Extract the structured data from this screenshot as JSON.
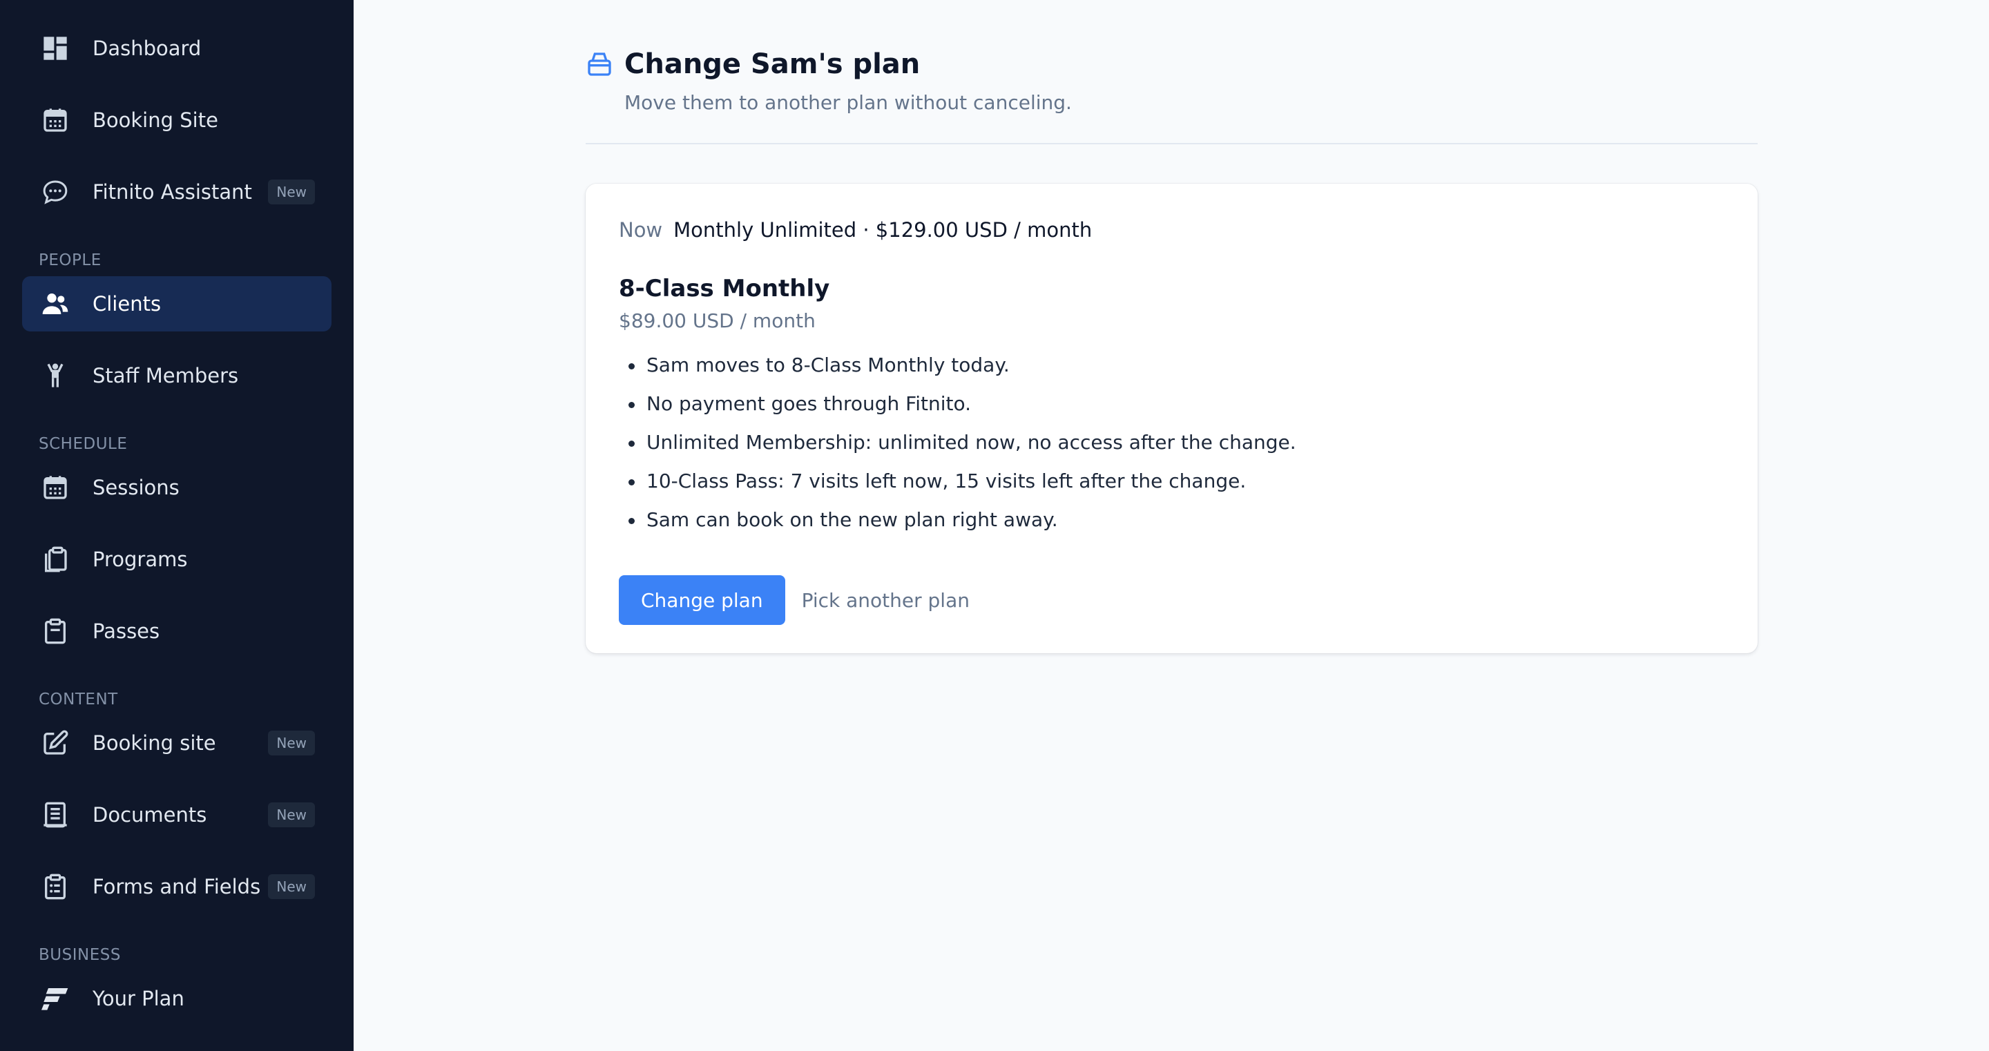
{
  "sidebar": {
    "top_items": [
      {
        "label": "Dashboard",
        "icon": "dashboard-icon"
      },
      {
        "label": "Booking Site",
        "icon": "calendar-icon"
      },
      {
        "label": "Fitnito Assistant",
        "icon": "chat-bubble-icon",
        "badge": "New"
      }
    ],
    "sections": {
      "people": {
        "label": "PEOPLE",
        "items": [
          {
            "label": "Clients",
            "icon": "users-icon",
            "active": true
          },
          {
            "label": "Staff Members",
            "icon": "person-icon"
          }
        ]
      },
      "schedule": {
        "label": "SCHEDULE",
        "items": [
          {
            "label": "Sessions",
            "icon": "calendar-icon"
          },
          {
            "label": "Programs",
            "icon": "clipboard-copy-icon"
          },
          {
            "label": "Passes",
            "icon": "clipboard-icon"
          }
        ]
      },
      "content": {
        "label": "CONTENT",
        "items": [
          {
            "label": "Booking site",
            "icon": "edit-icon",
            "badge": "New"
          },
          {
            "label": "Documents",
            "icon": "document-icon",
            "badge": "New"
          },
          {
            "label": "Forms and Fields",
            "icon": "clipboard-list-icon",
            "badge": "New"
          }
        ]
      },
      "business": {
        "label": "BUSINESS",
        "items": [
          {
            "label": "Your Plan",
            "icon": "fitnito-logo-icon"
          }
        ]
      }
    }
  },
  "header": {
    "title": "Change Sam's plan",
    "subtitle": "Move them to another plan without canceling.",
    "icon": "box-icon"
  },
  "card": {
    "now_label": "Now",
    "now_value": "Monthly Unlimited · $129.00 USD / month",
    "plan_name": "8-Class Monthly",
    "plan_price": "$89.00 USD / month",
    "bullets": [
      "Sam moves to 8-Class Monthly today.",
      "No payment goes through Fitnito.",
      "Unlimited Membership: unlimited now, no access after the change.",
      "10-Class Pass: 7 visits left now, 15 visits left after the change.",
      "Sam can book on the new plan right away."
    ],
    "primary_button": "Change plan",
    "secondary_button": "Pick another plan"
  },
  "colors": {
    "sidebar_bg": "#0f172a",
    "active_item_bg": "#172b54",
    "accent": "#3b82f6",
    "page_bg": "#f8fafc"
  }
}
